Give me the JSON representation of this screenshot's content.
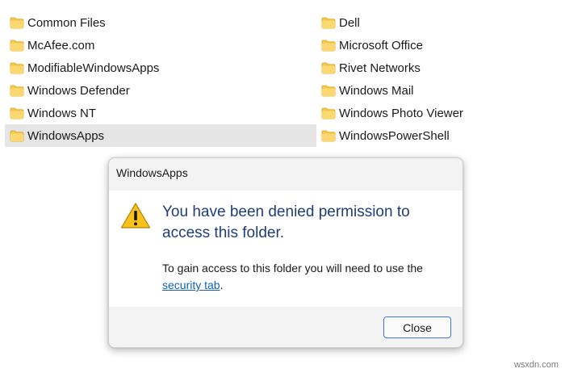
{
  "folders": {
    "column_1": [
      {
        "label": "Common Files"
      },
      {
        "label": "McAfee.com"
      },
      {
        "label": "ModifiableWindowsApps"
      },
      {
        "label": "Windows Defender"
      },
      {
        "label": "Windows NT"
      },
      {
        "label": "WindowsApps",
        "selected": true
      }
    ],
    "column_2": [
      {
        "label": "Dell"
      },
      {
        "label": "Microsoft Office"
      },
      {
        "label": "Rivet Networks"
      },
      {
        "label": "Windows Mail"
      },
      {
        "label": "Windows Photo Viewer"
      },
      {
        "label": "WindowsPowerShell"
      }
    ],
    "icon": "folder-icon",
    "folder_color": "#f7c948",
    "selection_color": "#e5e5e5"
  },
  "dialog": {
    "title": "WindowsApps",
    "icon": "warning-icon",
    "main_text": "You have been denied permission to access this folder.",
    "sub_text": "To gain access to this folder you will need to use the",
    "link_text": "security tab",
    "link_suffix": ".",
    "close_label": "Close",
    "main_text_color": "#1f3d7a",
    "link_color": "#1060b8",
    "accent_color": "#3a7bd5"
  },
  "watermark": "wsxdn.com"
}
